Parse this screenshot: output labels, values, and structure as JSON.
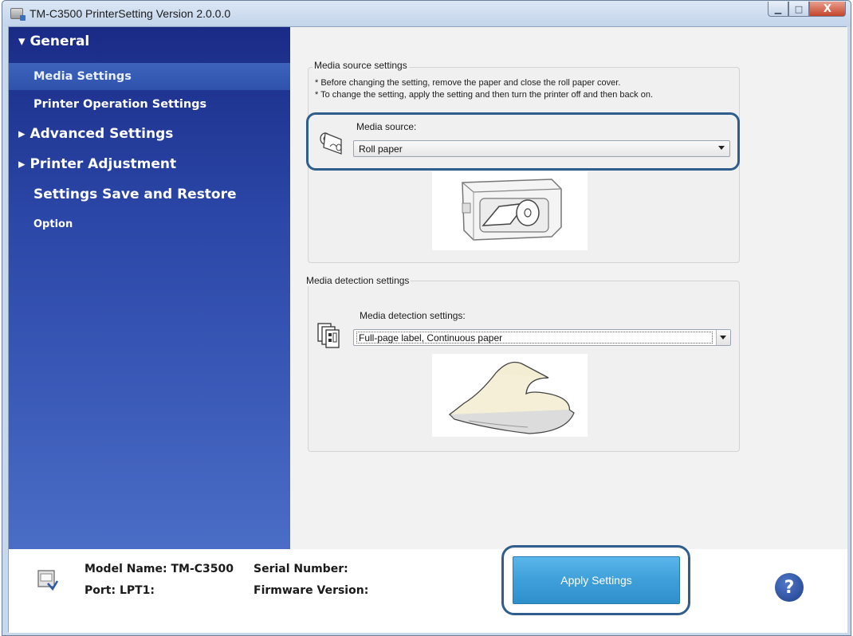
{
  "window": {
    "title": "TM-C3500 PrinterSetting Version 2.0.0.0",
    "controls": {
      "minimize": "▁",
      "maximize": "□",
      "close": "X"
    }
  },
  "sidebar": {
    "items": [
      {
        "label": "▾ General",
        "kind": "group",
        "state": "expanded"
      },
      {
        "label": "Media Settings",
        "kind": "sub",
        "state": "selected"
      },
      {
        "label": "Printer Operation Settings",
        "kind": "sub",
        "state": ""
      },
      {
        "label": "▸ Advanced Settings",
        "kind": "group",
        "state": "collapsed"
      },
      {
        "label": "▸ Printer Adjustment",
        "kind": "group",
        "state": "collapsed"
      },
      {
        "label": "Settings Save and Restore",
        "kind": "group",
        "state": ""
      },
      {
        "label": "Option",
        "kind": "small",
        "state": ""
      }
    ]
  },
  "media_source": {
    "legend": "Media source settings",
    "notes": [
      "* Before changing the setting, remove the paper and close the roll paper cover.",
      "* To change the setting, apply the setting and then turn the printer off and then back on."
    ],
    "label": "Media source:",
    "value": "Roll paper",
    "icon": "roll-paper-icon"
  },
  "media_detection": {
    "legend": "Media detection settings",
    "label": "Media detection settings:",
    "value": "Full-page label, Continuous paper",
    "icon": "label-sheets-icon"
  },
  "footer": {
    "model": "Model Name: TM-C3500",
    "port": "Port: LPT1:",
    "serial": "Serial Number:",
    "firmware": "Firmware Version:",
    "apply": "Apply Settings",
    "help": "?"
  },
  "colors": {
    "sidebar_top": "#1a2b86",
    "sidebar_bottom": "#4a6dc6",
    "highlight": "#2f5e8c",
    "apply_button": "#3e9fd9"
  }
}
